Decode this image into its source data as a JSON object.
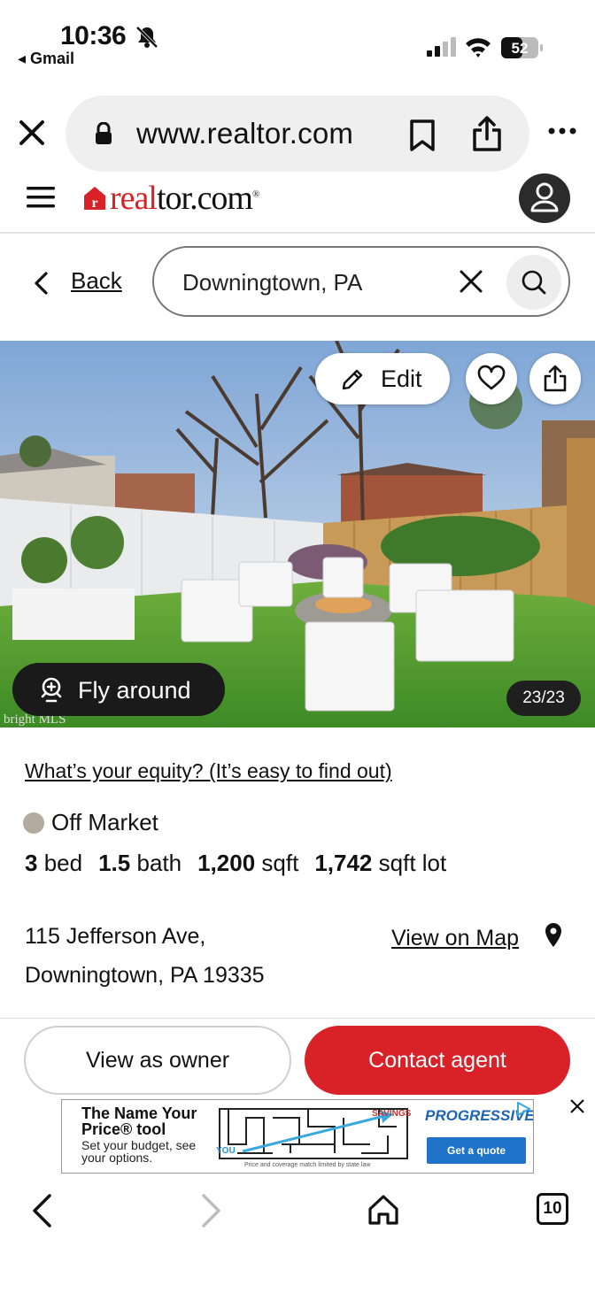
{
  "status_bar": {
    "time": "10:36",
    "back_app": "◂ Gmail",
    "battery": "52"
  },
  "browser": {
    "url": "www.realtor.com"
  },
  "site": {
    "logo_red": "real",
    "logo_dark": "tor.com",
    "brand_color": "#d92228"
  },
  "search": {
    "back_label": "Back",
    "value": "Downingtown, PA"
  },
  "photo": {
    "edit_label": "Edit",
    "fly_label": "Fly around",
    "counter": "23/23",
    "watermark": "bright MLS"
  },
  "listing": {
    "equity_link": "What’s your equity? (It’s easy to find out)",
    "status": "Off Market",
    "beds": "3",
    "beds_unit": "bed",
    "baths": "1.5",
    "baths_unit": "bath",
    "sqft": "1,200",
    "sqft_unit": "sqft",
    "lot": "1,742",
    "lot_unit": "sqft lot",
    "address_line1": "115 Jefferson Ave,",
    "address_line2": "Downingtown, PA 19335",
    "map_link": "View on Map"
  },
  "actions": {
    "owner_label": "View as owner",
    "agent_label": "Contact agent"
  },
  "ad": {
    "headline": "The Name Your Price® tool",
    "sub": "Set your budget, see your options.",
    "savings": "SAVINGS",
    "you": "YOU",
    "fine_print": "Price and coverage match limited by state law",
    "brand": "PROGRESSIVE",
    "cta": "Get a quote"
  },
  "nav": {
    "tab_count": "10"
  }
}
